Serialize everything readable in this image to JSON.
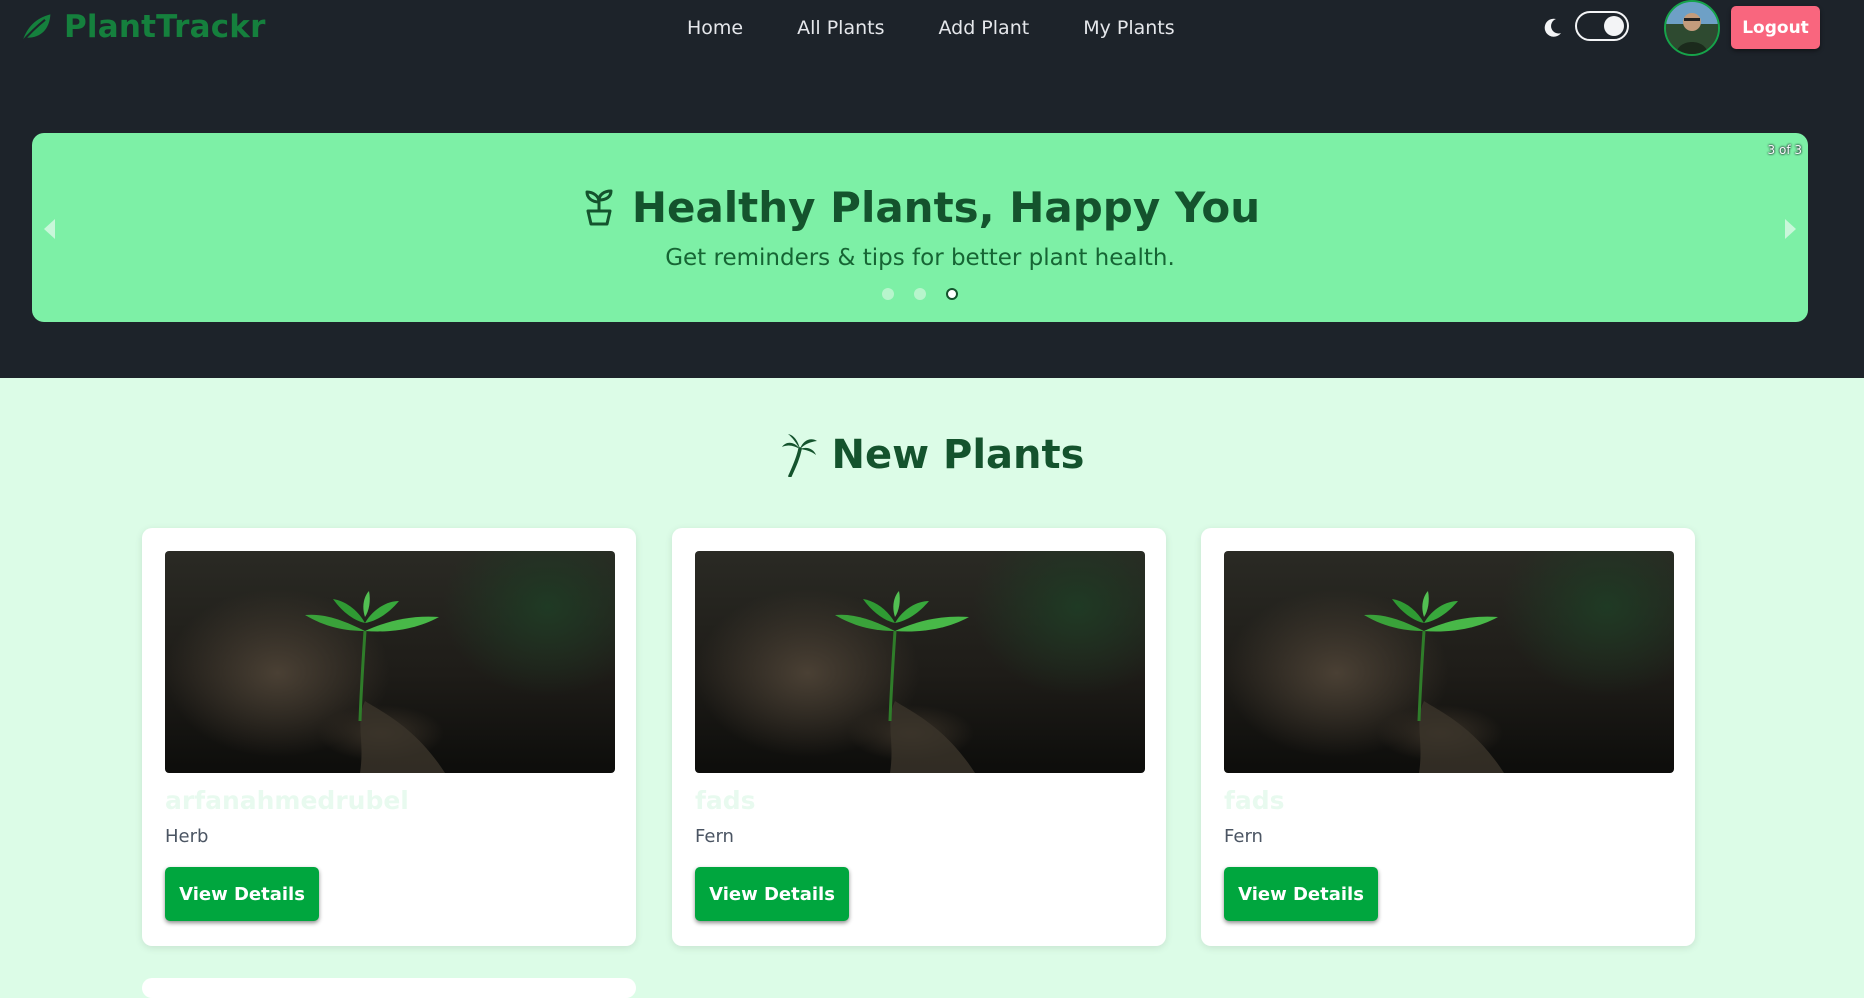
{
  "brand": {
    "name": "PlantTrackr",
    "icon": "leaf-icon",
    "color": "#15803d"
  },
  "nav": {
    "links": [
      {
        "label": "Home"
      },
      {
        "label": "All Plants"
      },
      {
        "label": "Add Plant"
      },
      {
        "label": "My Plants"
      }
    ]
  },
  "header_actions": {
    "theme_icon": "moon-icon",
    "theme_toggle_on": true,
    "logout_label": "Logout",
    "logout_color": "#f9667e"
  },
  "banner": {
    "counter": "3 of 3",
    "icon": "sprout-icon",
    "title": "Healthy Plants, Happy You",
    "subtitle": "Get reminders & tips for better plant health.",
    "slides_total": 3,
    "active_slide": 3,
    "background": "#7df0a6"
  },
  "section": {
    "icon": "palm-tree-icon",
    "title": "New Plants"
  },
  "cards": [
    {
      "name": "arfanahmedrubel",
      "type": "Herb",
      "button_label": "View Details"
    },
    {
      "name": "fads",
      "type": "Fern",
      "button_label": "View Details"
    },
    {
      "name": "fads",
      "type": "Fern",
      "button_label": "View Details"
    }
  ],
  "colors": {
    "navbar_bg": "#1d232a",
    "page_bg": "#dcfce7",
    "button_green": "#00a63e",
    "heading_green": "#14532d"
  }
}
